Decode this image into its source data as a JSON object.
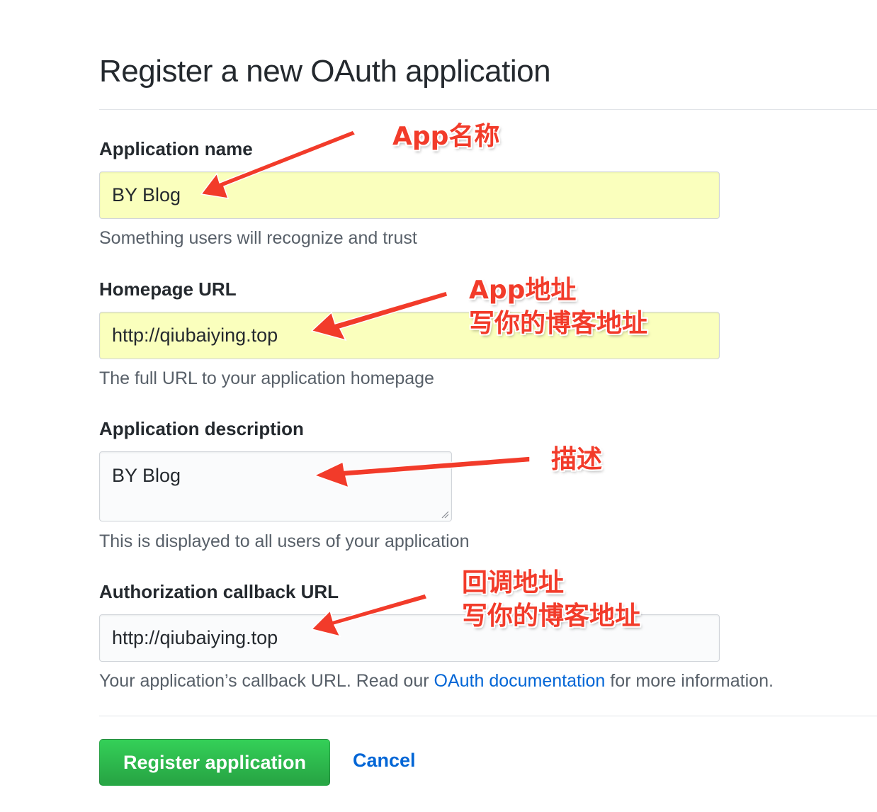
{
  "form": {
    "title": "Register a new OAuth application",
    "app_name": {
      "label": "Application name",
      "value": "BY Blog",
      "note": "Something users will recognize and trust"
    },
    "homepage_url": {
      "label": "Homepage URL",
      "value": "http://qiubaiying.top",
      "note": "The full URL to your application homepage"
    },
    "description": {
      "label": "Application description",
      "value": "BY Blog",
      "note": "This is displayed to all users of your application"
    },
    "callback_url": {
      "label": "Authorization callback URL",
      "value": "http://qiubaiying.top",
      "note_prefix": "Your application’s callback URL. Read our ",
      "note_link": "OAuth documentation",
      "note_suffix": " for more information."
    },
    "register_button": "Register application",
    "cancel_link": "Cancel"
  },
  "annotations": {
    "app_name": "App名称",
    "homepage_line1": "App地址",
    "homepage_line2": "写你的博客地址",
    "description": "描述",
    "callback_line1": "回调地址",
    "callback_line2": "写你的博客地址"
  },
  "colors": {
    "autofill_bg": "#faffbd",
    "primary_button": "#28a745",
    "link": "#0366d6",
    "annotation": "#f23b2a"
  }
}
